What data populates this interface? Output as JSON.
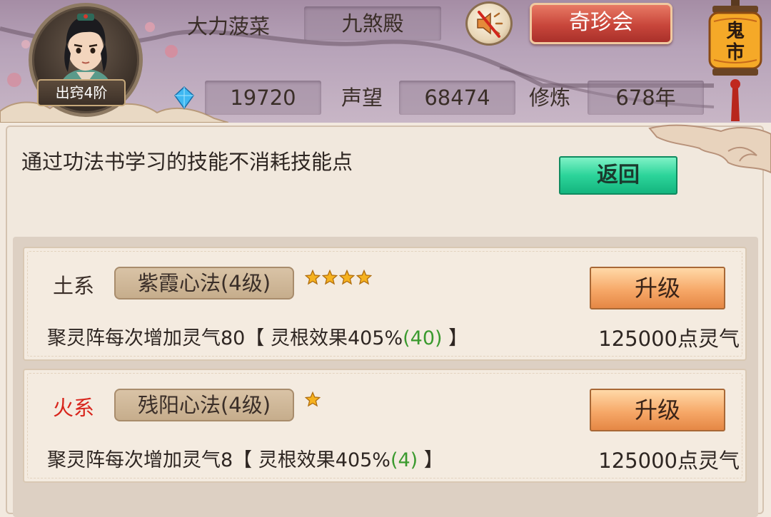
{
  "header": {
    "player_name": "大力菠菜",
    "sect_name": "九煞殿",
    "rank_badge": "出窍4阶",
    "gems": "19720",
    "reputation_label": "声望",
    "reputation_value": "68474",
    "cultivation_label": "修炼",
    "cultivation_value": "678年",
    "treasure_button": "奇珍会",
    "ghost_market_icon": "鬼市",
    "sound_state": "muted"
  },
  "main": {
    "notice": "通过功法书学习的技能不消耗技能点",
    "back_button": "返回",
    "skills": [
      {
        "element": "土系",
        "element_color": "#3a2e28",
        "name": "紫霞心法(4级)",
        "stars": 4,
        "upgrade_label": "升级",
        "effect_prefix": "聚灵阵每次增加灵气80【 灵根效果405%",
        "effect_bonus": "(40)",
        "effect_suffix": " 】",
        "cost": "125000点灵气"
      },
      {
        "element": "火系",
        "element_color": "#d8251c",
        "name": "残阳心法(4级)",
        "stars": 1,
        "upgrade_label": "升级",
        "effect_prefix": "聚灵阵每次增加灵气8【 灵根效果405%",
        "effect_bonus": "(4)",
        "effect_suffix": " 】",
        "cost": "125000点灵气"
      }
    ]
  }
}
